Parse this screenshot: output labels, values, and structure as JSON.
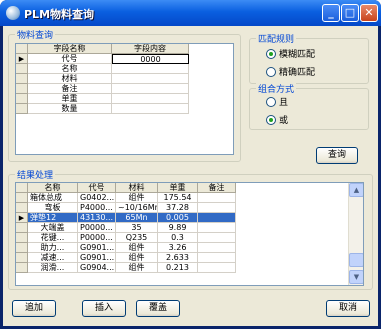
{
  "window": {
    "title": "PLM物料查询"
  },
  "query_group": {
    "label": "物料查询",
    "headers": [
      "字段名称",
      "字段内容"
    ],
    "rows": [
      {
        "field": "代号",
        "value": "0000",
        "current": true
      },
      {
        "field": "名称",
        "value": ""
      },
      {
        "field": "材料",
        "value": ""
      },
      {
        "field": "备注",
        "value": ""
      },
      {
        "field": "单重",
        "value": ""
      },
      {
        "field": "数量",
        "value": ""
      }
    ]
  },
  "match_group": {
    "label": "匹配规则",
    "options": [
      {
        "label": "模糊匹配",
        "checked": true
      },
      {
        "label": "精确匹配",
        "checked": false
      }
    ]
  },
  "combine_group": {
    "label": "组合方式",
    "options": [
      {
        "label": "且",
        "checked": false
      },
      {
        "label": "或",
        "checked": true
      }
    ]
  },
  "query_button": "查询",
  "result_group": {
    "label": "结果处理",
    "headers": [
      "名称",
      "代号",
      "材料",
      "单重",
      "备注"
    ],
    "rows": [
      {
        "name": "箱体总成",
        "code": "G0402...",
        "material": "组件",
        "weight": "175.54",
        "note": ""
      },
      {
        "name": "弯板",
        "code": "P4000...",
        "material": "~10/16Mn",
        "weight": "37.28",
        "note": ""
      },
      {
        "name": "弹垫12",
        "code": "43130...",
        "material": "65Mn",
        "weight": "0.005",
        "note": "",
        "selected": true
      },
      {
        "name": "大端盖",
        "code": "P0000...",
        "material": "35",
        "weight": "9.89",
        "note": ""
      },
      {
        "name": "花键...",
        "code": "P0000...",
        "material": "Q235",
        "weight": "0.3",
        "note": ""
      },
      {
        "name": "助力...",
        "code": "G0901...",
        "material": "组件",
        "weight": "3.26",
        "note": ""
      },
      {
        "name": "减速...",
        "code": "G0901...",
        "material": "组件",
        "weight": "2.633",
        "note": ""
      },
      {
        "name": "润滑...",
        "code": "G0904...",
        "material": "组件",
        "weight": "0.213",
        "note": ""
      }
    ]
  },
  "buttons": {
    "add": "追加",
    "insert": "插入",
    "overwrite": "覆盖",
    "cancel": "取消"
  }
}
